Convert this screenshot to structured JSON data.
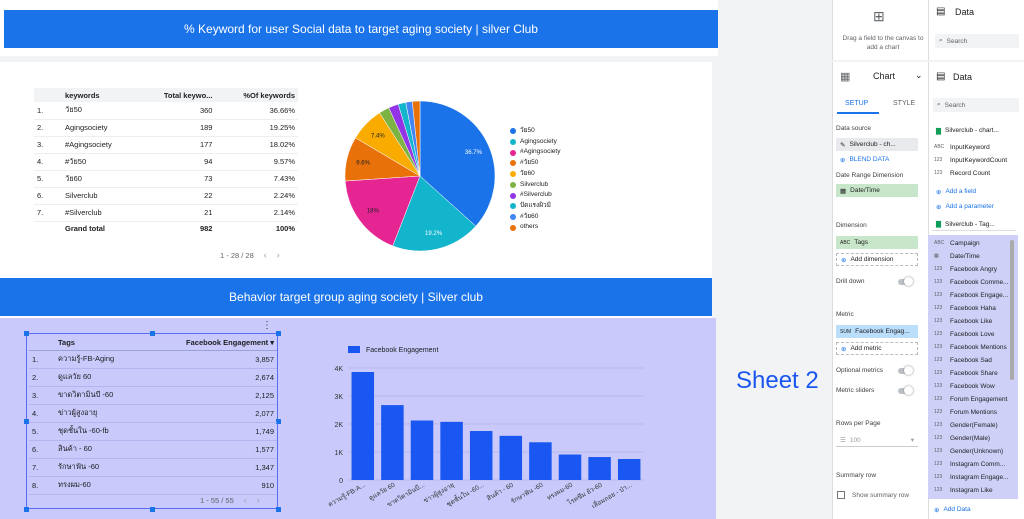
{
  "banner1": "% Keyword  for user Social data to target aging society | silver Club",
  "banner2": "Behavior target group aging society | Silver club",
  "sheet_label": "Sheet 2",
  "table1": {
    "headers": [
      "",
      "keywords",
      "Total keywo...",
      "%Of keywords"
    ],
    "rows": [
      [
        "1.",
        "วัย50",
        "360",
        "36.66%"
      ],
      [
        "2.",
        "Agingsociety",
        "189",
        "19.25%"
      ],
      [
        "3.",
        "#Agingsociety",
        "177",
        "18.02%"
      ],
      [
        "4.",
        "#วัย50",
        "94",
        "9.57%"
      ],
      [
        "5.",
        "วัย60",
        "73",
        "7.43%"
      ],
      [
        "6.",
        "Silverclub",
        "22",
        "2.24%"
      ],
      [
        "7.",
        "#Silverclub",
        "21",
        "2.14%"
      ]
    ],
    "grand_label": "Grand total",
    "grand_total": "982",
    "grand_pct": "100%",
    "pager": "1 - 28 / 28"
  },
  "pie": {
    "labels": [
      "36.7%",
      "19.2%",
      "18%",
      "9.6%",
      "7.4%"
    ],
    "legend": [
      "วัย50",
      "Agingsociety",
      "#Agingsociety",
      "#วัย50",
      "วัย60",
      "Silverclub",
      "#Silverclub",
      "ปัดแรงผิวมิ",
      "#วัย60",
      "others"
    ],
    "colors": [
      "#1a73e8",
      "#12b5cb",
      "#e52592",
      "#e8710a",
      "#f9ab00",
      "#7cb342",
      "#9334e6",
      "#12b5cb",
      "#4285f4",
      "#e8710a"
    ]
  },
  "table2": {
    "headers": [
      "",
      "Tags",
      "Facebook Engagement ▾"
    ],
    "rows": [
      [
        "1.",
        "ความรู้-FB-Aging",
        "3,857"
      ],
      [
        "2.",
        "ดูแลวัย 60",
        "2,674"
      ],
      [
        "3.",
        "ขาดวิตามินบี -60",
        "2,125"
      ],
      [
        "4.",
        "ข่าวผู้สูงอายุ",
        "2,077"
      ],
      [
        "5.",
        "ชุดชั้นใน -60-fb",
        "1,749"
      ],
      [
        "6.",
        "สินค้า - 60",
        "1,577"
      ],
      [
        "7.",
        "รักษาฟัน -60",
        "1,347"
      ],
      [
        "8.",
        "ทรงผม-60",
        "910"
      ]
    ],
    "pager": "1 - 55 / 55"
  },
  "chart_data": {
    "type": "bar",
    "series": [
      {
        "name": "Facebook Engagement",
        "values": [
          3857,
          2674,
          2125,
          2077,
          1749,
          1577,
          1347,
          910,
          820,
          750
        ]
      }
    ],
    "categories": [
      "ความรู้-FB-A...",
      "ดูแลวัย 60",
      "ขาดวิตามินบี...",
      "ข่าวผู้สูงอายุ",
      "ชุดชั้นใน -60...",
      "สินค้า - 60",
      "รักษาฟัน -60",
      "ทรงผม-60",
      "โรคซึม ยัว-60",
      "เสื่อมถอย - ป่า..."
    ],
    "yticks": [
      "0",
      "1K",
      "2K",
      "3K",
      "4K"
    ],
    "ylim": [
      0,
      4000
    ],
    "color": "#1a56f0"
  },
  "top_panel": {
    "hint": "Drag a field to the canvas to add a chart",
    "data_title": "Data",
    "search": "Search"
  },
  "setup": {
    "chart_label": "Chart",
    "tab_setup": "SETUP",
    "tab_style": "STYLE",
    "data_source_label": "Data source",
    "data_source": "Silverclub - ch...",
    "blend": "BLEND DATA",
    "date_range_label": "Date Range Dimension",
    "date_range": "Date/Time",
    "dimension_label": "Dimension",
    "dimension": "Tags",
    "add_dimension": "Add dimension",
    "drill_down": "Drill down",
    "metric_label": "Metric",
    "metric": "Facebook Engag...",
    "metric_prefix": "SUM",
    "add_metric": "Add metric",
    "optional_metrics": "Optional metrics",
    "metric_sliders": "Metric sliders",
    "rows_per_page": "Rows per Page",
    "rows_value": "100",
    "summary_row": "Summary row",
    "show_summary": "Show summary row"
  },
  "data_panel": {
    "title": "Data",
    "search": "Search",
    "source1": "Silverclub - chart...",
    "fields1": [
      [
        "ABC",
        "InputKeyword"
      ],
      [
        "123",
        "InputKeywordCount"
      ],
      [
        "123",
        "Record Count"
      ]
    ],
    "add_field": "Add a field",
    "add_parameter": "Add a parameter",
    "source2": "Silverclub - Tag...",
    "fields2": [
      [
        "ABC",
        "Campaign"
      ],
      [
        "▦",
        "Date/Time"
      ],
      [
        "123",
        "Facebook Angry"
      ],
      [
        "123",
        "Facebook Comme..."
      ],
      [
        "123",
        "Facebook Engage..."
      ],
      [
        "123",
        "Facebook Haha"
      ],
      [
        "123",
        "Facebook Like"
      ],
      [
        "123",
        "Facebook Love"
      ],
      [
        "123",
        "Facebook Mentions"
      ],
      [
        "123",
        "Facebook Sad"
      ],
      [
        "123",
        "Facebook Share"
      ],
      [
        "123",
        "Facebook Wow"
      ],
      [
        "123",
        "Forum Engagement"
      ],
      [
        "123",
        "Forum Mentions"
      ],
      [
        "123",
        "Gender(Female)"
      ],
      [
        "123",
        "Gender(Male)"
      ],
      [
        "123",
        "Gender(Unknown)"
      ],
      [
        "123",
        "Instagram Comm..."
      ],
      [
        "123",
        "Instagram Engage..."
      ],
      [
        "123",
        "Instagram Like"
      ]
    ],
    "add_data": "Add Data"
  }
}
